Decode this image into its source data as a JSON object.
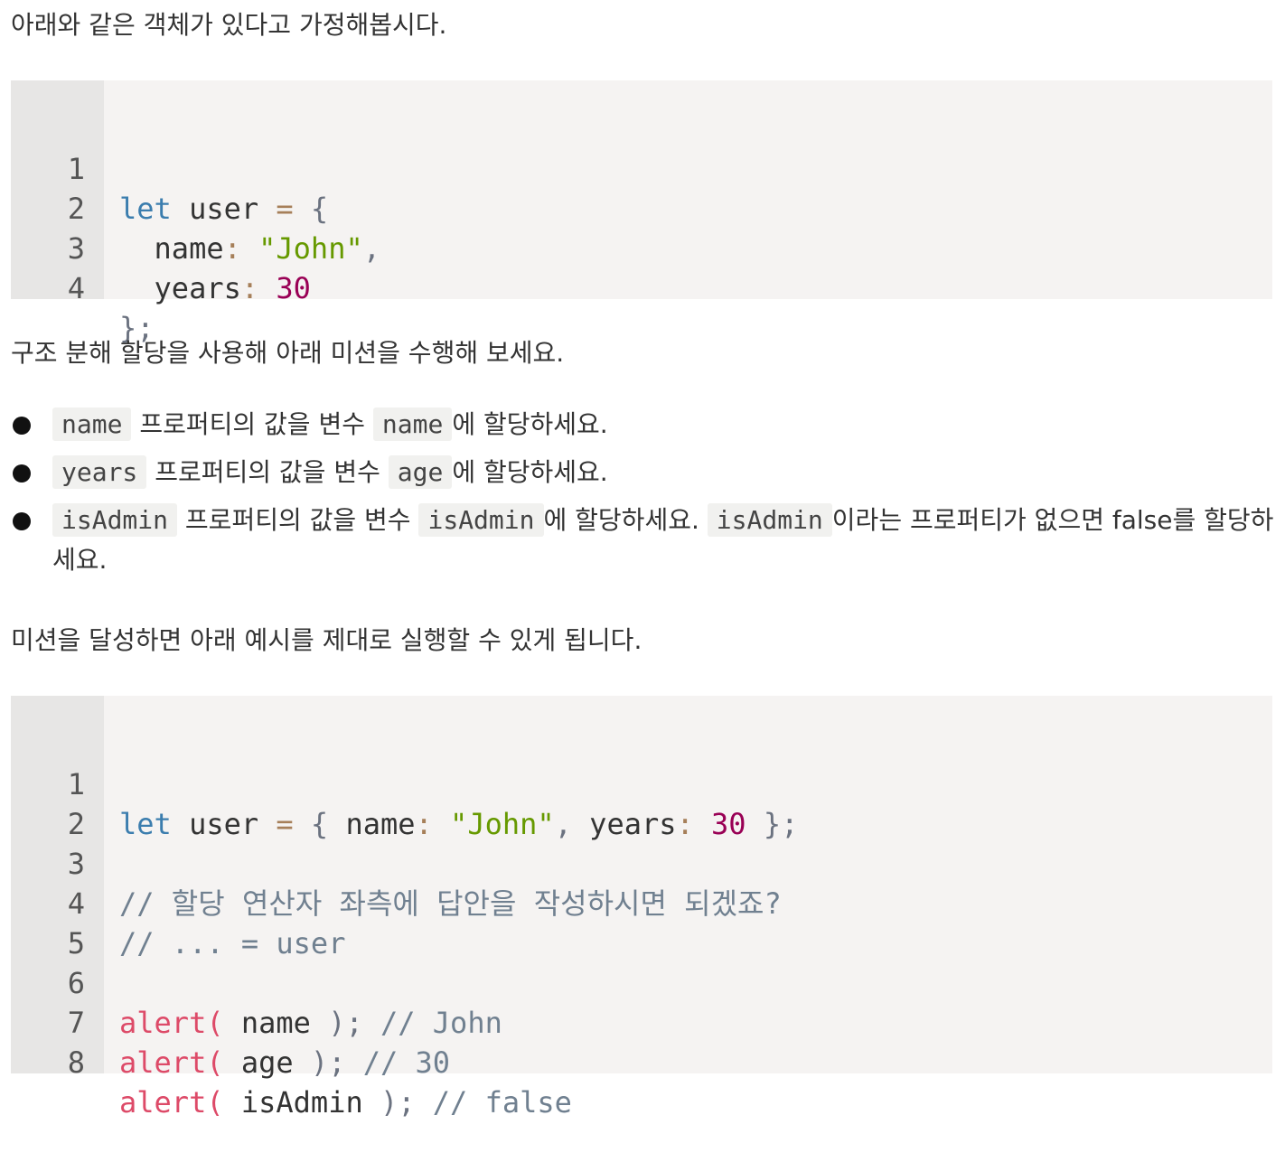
{
  "intro_text": "아래와 같은 객체가 있다고 가정해봅시다.",
  "code1": {
    "line_numbers": [
      "1",
      "2",
      "3",
      "4"
    ],
    "line1": {
      "kw": "let",
      "ident": "user",
      "op": "=",
      "punct": "{"
    },
    "line2": {
      "key": "name",
      "colon": ":",
      "value": "\"John\"",
      "comma": ","
    },
    "line3": {
      "key": "years",
      "colon": ":",
      "value": "30"
    },
    "line4": {
      "punct": "};"
    }
  },
  "task_text": "구조 분해 할당을 사용해 아래 미션을 수행해 보세요.",
  "missions": [
    {
      "code_a": "name",
      "text_a": "프로퍼티의 값을 변수",
      "code_b": "name",
      "text_b": "에 할당하세요."
    },
    {
      "code_a": "years",
      "text_a": "프로퍼티의 값을 변수",
      "code_b": "age",
      "text_b": "에 할당하세요."
    },
    {
      "code_a": "isAdmin",
      "text_a": "프로퍼티의 값을 변수",
      "code_b": "isAdmin",
      "text_b": "에 할당하세요.",
      "code_c": "isAdmin",
      "text_c": "이라는 프로퍼티가 없으면 false를 할당하세요."
    }
  ],
  "result_text": "미션을 달성하면 아래 예시를 제대로 실행할 수 있게 됩니다.",
  "code2": {
    "line_numbers": [
      "1",
      "2",
      "3",
      "4",
      "5",
      "6",
      "7",
      "8"
    ],
    "line1": {
      "kw": "let",
      "ident": "user",
      "op": "=",
      "open": "{",
      "key1": "name",
      "colon1": ":",
      "val1": "\"John\"",
      "comma": ",",
      "key2": "years",
      "colon2": ":",
      "val2": "30",
      "close": "};"
    },
    "line3_comment": "// 할당 연산자 좌측에 답안을 작성하시면 되겠죠?",
    "line4_comment": "// ... = user",
    "line6": {
      "fn": "alert(",
      "arg": "name",
      "close": ");",
      "comment": "// John"
    },
    "line7": {
      "fn": "alert(",
      "arg": "age",
      "close": ");",
      "comment": "// 30"
    },
    "line8": {
      "fn": "alert(",
      "arg": "isAdmin",
      "close": ");",
      "comment": "// false"
    }
  }
}
